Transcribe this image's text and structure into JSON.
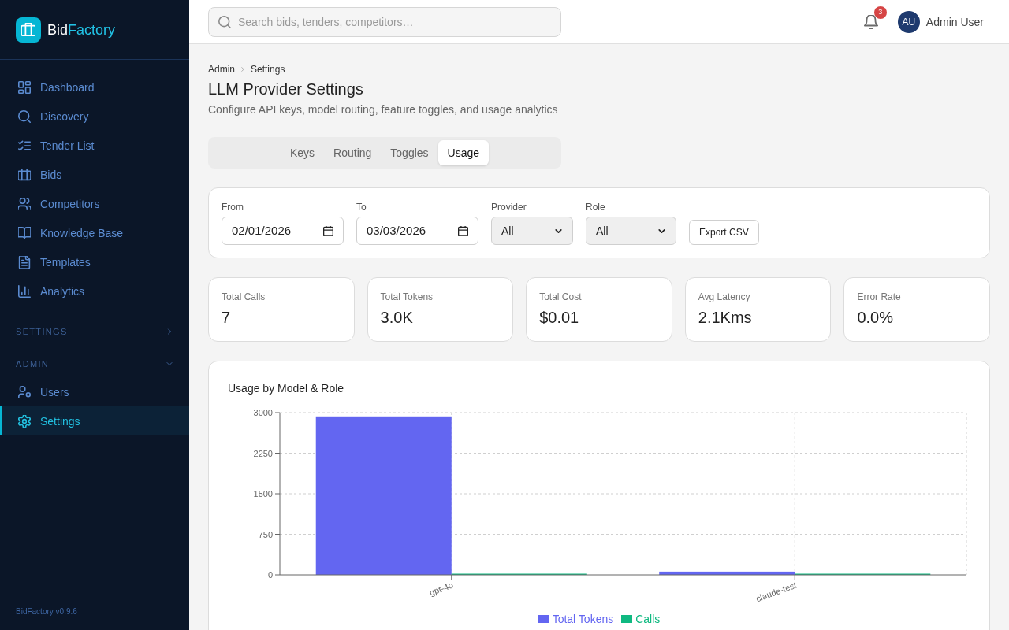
{
  "sidebar": {
    "brand": {
      "prefix": "Bid",
      "suffix": "Factory"
    },
    "nav": [
      {
        "label": "Dashboard",
        "selected": false
      },
      {
        "label": "Discovery",
        "selected": false
      },
      {
        "label": "Tender List",
        "selected": false
      },
      {
        "label": "Bids",
        "selected": false
      },
      {
        "label": "Competitors",
        "selected": false
      },
      {
        "label": "Knowledge Base",
        "selected": false
      },
      {
        "label": "Templates",
        "selected": false
      },
      {
        "label": "Analytics",
        "selected": false
      }
    ],
    "sections": [
      {
        "label": "SETTINGS",
        "expanded": false
      },
      {
        "label": "ADMIN",
        "expanded": true,
        "items": [
          {
            "label": "Users",
            "selected": false
          },
          {
            "label": "Settings",
            "selected": true
          }
        ]
      }
    ],
    "version": "BidFactory v0.9.6"
  },
  "topbar": {
    "search": {
      "placeholder": "Search bids, tenders, competitors…"
    },
    "notifications": {
      "count": "3"
    },
    "user": {
      "initials": "AU",
      "name": "Admin User"
    }
  },
  "page": {
    "breadcrumb": [
      "Admin",
      "Settings"
    ],
    "title": "LLM Provider Settings",
    "subtitle": "Configure API keys, model routing, feature toggles, and usage analytics",
    "tabs": [
      {
        "label": "Keys",
        "selected": false
      },
      {
        "label": "Routing",
        "selected": false
      },
      {
        "label": "Toggles",
        "selected": false
      },
      {
        "label": "Usage",
        "selected": true
      }
    ],
    "filters": [
      {
        "kind": "date",
        "label": "From",
        "value": "02/01/2026"
      },
      {
        "kind": "date",
        "label": "To",
        "value": "03/03/2026"
      },
      {
        "kind": "select",
        "label": "Provider",
        "value": "All"
      },
      {
        "kind": "select",
        "label": "Role",
        "value": "All"
      }
    ],
    "export_button": "Export CSV",
    "stats": [
      {
        "label": "Total Calls",
        "value": "7"
      },
      {
        "label": "Total Tokens",
        "value": "3.0K"
      },
      {
        "label": "Total Cost",
        "value": "$0.01"
      },
      {
        "label": "Avg Latency",
        "value": "2.1Kms"
      },
      {
        "label": "Error Rate",
        "value": "0.0%"
      }
    ],
    "chart_card": {
      "chart_data": {
        "type": "bar",
        "title": "Usage by Model & Role",
        "categories": [
          "gpt-4o",
          "claude-test"
        ],
        "series": [
          {
            "name": "Total Tokens",
            "color": "#6366f1",
            "values": [
              2930,
              60
            ]
          },
          {
            "name": "Calls",
            "color": "#10b981",
            "values": [
              0,
              0
            ]
          }
        ],
        "ylim": [
          0,
          3000
        ],
        "yticks": [
          0,
          750,
          1500,
          2250,
          3000
        ],
        "grid": true,
        "legend": true
      }
    }
  }
}
